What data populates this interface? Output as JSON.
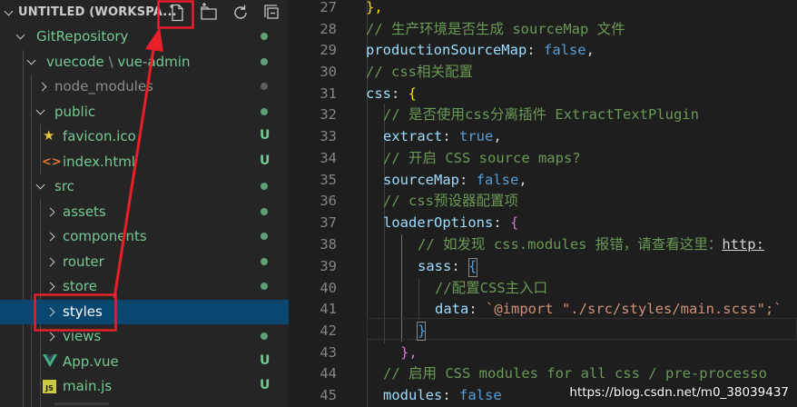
{
  "explorer": {
    "workspace_title": "UNTITLED (WORKSPA...",
    "toolbar": {
      "new_file_icon": "new-file-icon",
      "new_folder_icon": "new-folder-icon",
      "refresh_icon": "refresh-icon",
      "collapse_icon": "collapse-all-icon"
    },
    "tree": {
      "git_repository": "GitRepository",
      "vuecode": "vuecode",
      "path_separator": "\\",
      "vue_admin": "vue-admin",
      "node_modules": "node_modules",
      "public": "public",
      "favicon": "favicon.ico",
      "index_html": "index.html",
      "src": "src",
      "assets": "assets",
      "components": "components",
      "router": "router",
      "store": "store",
      "styles": "styles",
      "views": "views",
      "app_vue": "App.vue",
      "main_js": "main.js",
      "untracked_badge": "U"
    },
    "colors": {
      "untracked": "#73c991",
      "selected_row": "#094771",
      "annotation": "#e8202a"
    }
  },
  "editor": {
    "line_numbers": [
      "27",
      "28",
      "29",
      "30",
      "31",
      "32",
      "33",
      "34",
      "35",
      "36",
      "37",
      "38",
      "39",
      "40",
      "41",
      "42",
      "43",
      "44",
      "45"
    ],
    "lines": {
      "l27": "},",
      "l28": "// 生产环境是否生成 sourceMap 文件",
      "l29_key": "productionSourceMap",
      "l29_val": "false",
      "l30": "// css相关配置",
      "l31_key": "css",
      "l32": "// 是否使用css分离插件 ExtractTextPlugin",
      "l33_key": "extract",
      "l33_val": "true",
      "l34": "// 开启 CSS source maps?",
      "l35_key": "sourceMap",
      "l35_val": "false",
      "l36": "// css预设器配置项",
      "l37_key": "loaderOptions",
      "l38_text": "// 如发现 css.modules 报错，请查看这里：",
      "l38_link": "http:",
      "l39_key": "sass",
      "l40": "//配置CSS主入口",
      "l41_key": "data",
      "l41_val": "`@import \"./src/styles/main.scss\";`",
      "l42": "}",
      "l43": "},",
      "l44": "// 启用 CSS modules for all css / pre-processo",
      "l45_key": "modules",
      "l45_val": "false"
    }
  },
  "watermark": "https://blog.csdn.net/m0_38039437"
}
